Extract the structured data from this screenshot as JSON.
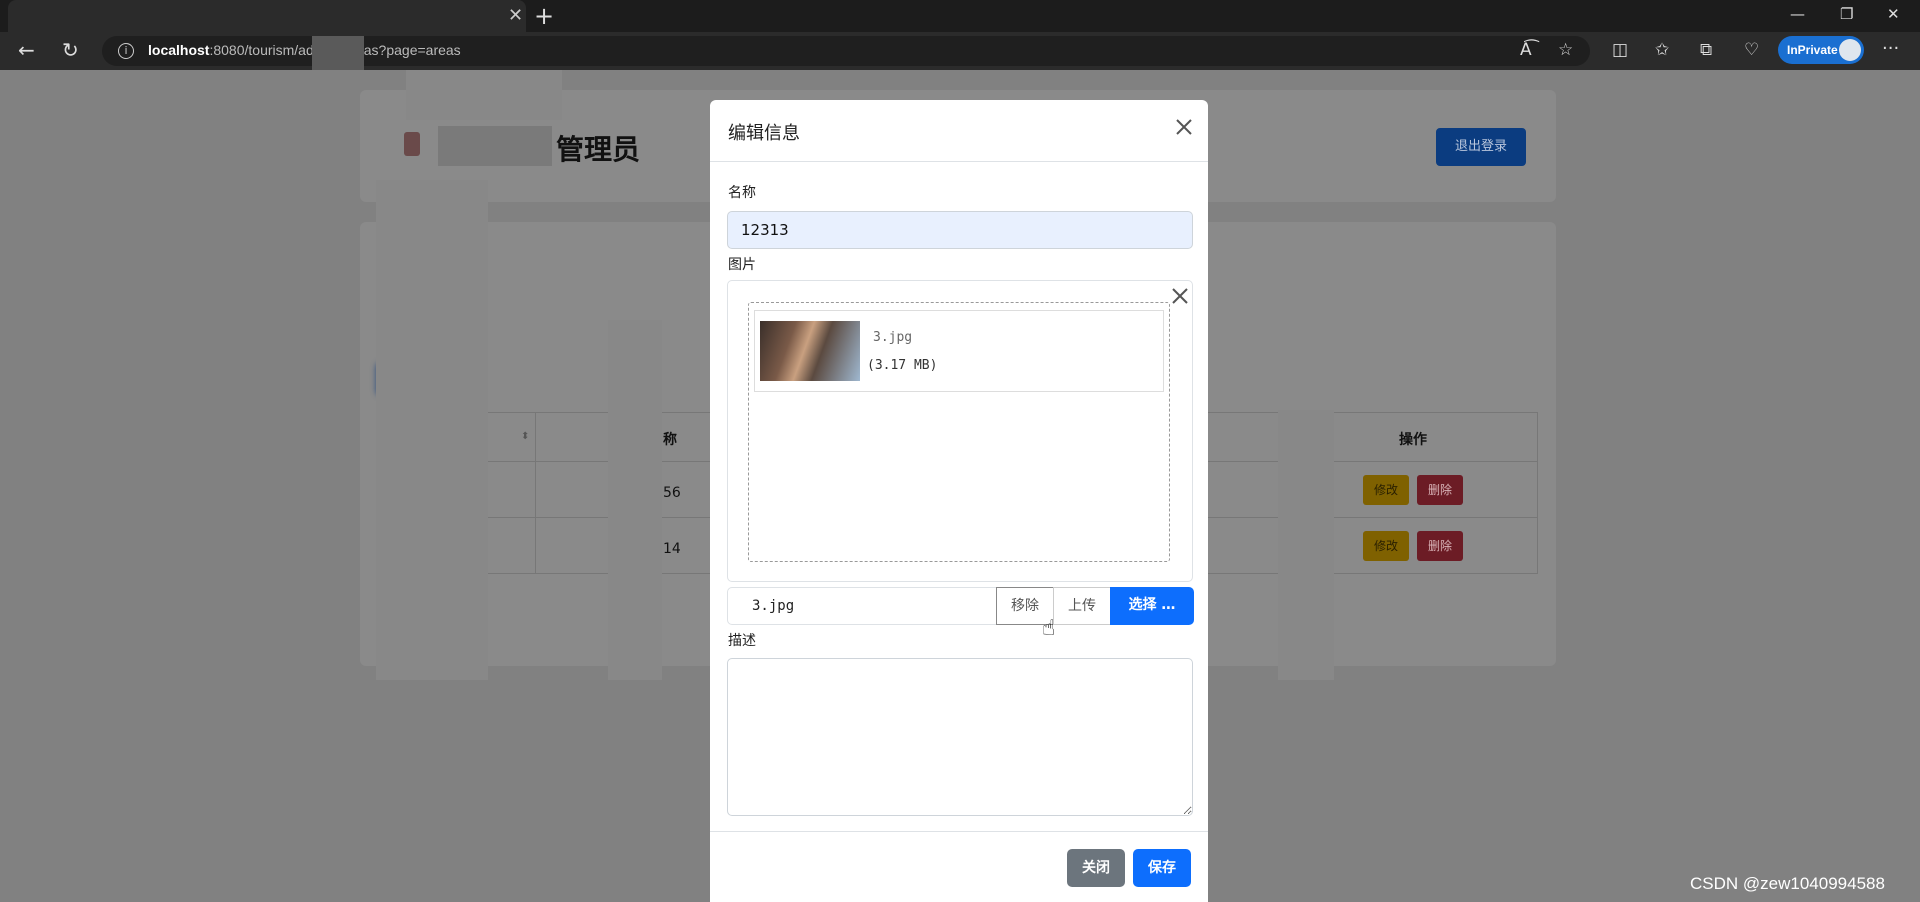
{
  "browser": {
    "url_host": "localhost",
    "url_rest_left": ":8080/tourism/ad",
    "url_rest_right": "as?page=areas",
    "inprivate_label": "InPrivate"
  },
  "page": {
    "admin_title": "管理员",
    "logout_label": "退出登录",
    "table": {
      "header_name_suffix": "称",
      "header_actions": "操作",
      "rows": [
        {
          "name_suffix": "56",
          "edit": "修改",
          "delete": "删除"
        },
        {
          "name_suffix": "14",
          "edit": "修改",
          "delete": "删除"
        }
      ]
    }
  },
  "modal": {
    "title": "编辑信息",
    "name_label": "名称",
    "name_value": "12313",
    "image_label": "图片",
    "file": {
      "name": "3.jpg",
      "size": "(3.17 MB)"
    },
    "file_caption": "3.jpg",
    "remove_label": "移除",
    "upload_label": "上传",
    "browse_label": "选择 …",
    "description_label": "描述",
    "description_value": "",
    "close_label": "关闭",
    "save_label": "保存"
  },
  "watermark": "CSDN @zew1040994588",
  "colors": {
    "primary": "#0d6efd",
    "secondary": "#6c757d",
    "warning": "#ffc107",
    "danger": "#dc3545",
    "input_autofill": "#e8f0fe"
  }
}
